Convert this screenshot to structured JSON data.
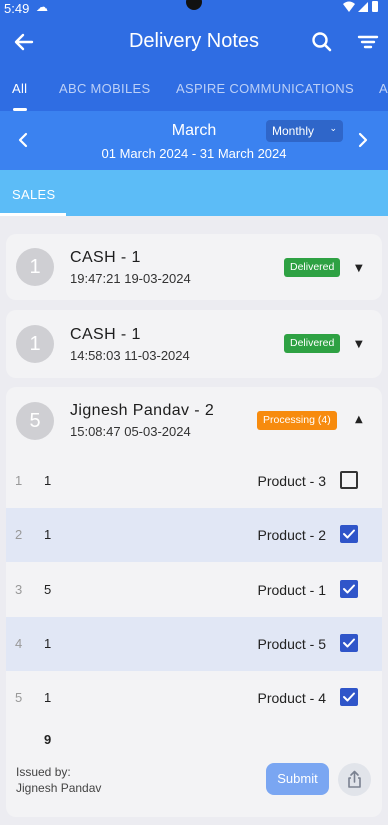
{
  "status_bar": {
    "time": "5:49",
    "cloud_icon": "cloud-icon",
    "system_icons": "wifi-signal-battery"
  },
  "app_bar": {
    "title": "Delivery Notes"
  },
  "tabs": [
    {
      "label": "All",
      "active": true
    },
    {
      "label": "ABC MOBILES",
      "active": false
    },
    {
      "label": "ASPIRE COMMUNICATIONS",
      "active": false
    },
    {
      "label": "A",
      "active": false
    }
  ],
  "period_bar": {
    "month": "March",
    "date_range": "01 March 2024 - 31 March 2024",
    "period_select": "Monthly"
  },
  "sub_tab": {
    "label": "SALES"
  },
  "notes": [
    {
      "avatar": "1",
      "title": "CASH - 1",
      "time": "19:47:21 19-03-2024",
      "status": "Delivered",
      "status_color": "#2ea143",
      "expanded": false
    },
    {
      "avatar": "1",
      "title": "CASH - 1",
      "time": "14:58:03 11-03-2024",
      "status": "Delivered",
      "status_color": "#2ea143",
      "expanded": false
    },
    {
      "avatar": "5",
      "title": "Jignesh Pandav - 2",
      "time": "15:08:47 05-03-2024",
      "status": "Processing (4)",
      "status_color": "#f78b0e",
      "expanded": true
    }
  ],
  "items": [
    {
      "index": "1",
      "qty": "1",
      "product": "Product - 3",
      "checked": false
    },
    {
      "index": "2",
      "qty": "1",
      "product": "Product - 2",
      "checked": true
    },
    {
      "index": "3",
      "qty": "5",
      "product": "Product - 1",
      "checked": true
    },
    {
      "index": "4",
      "qty": "1",
      "product": "Product - 5",
      "checked": true
    },
    {
      "index": "5",
      "qty": "1",
      "product": "Product - 4",
      "checked": true
    }
  ],
  "total_qty": "9",
  "issued": {
    "label": "Issued by:",
    "name": "Jignesh Pandav"
  },
  "actions": {
    "submit": "Submit",
    "share_icon": "share-icon"
  },
  "colors": {
    "primary": "#2f6de3",
    "period_bar": "#3b82f0",
    "sub_tab": "#5cbcf7",
    "checkbox": "#2f55c9",
    "submit": "#7aa6f2"
  }
}
